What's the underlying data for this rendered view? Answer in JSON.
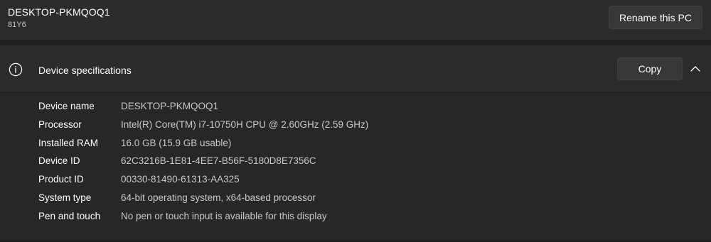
{
  "pc": {
    "name": "DESKTOP-PKMQOQ1",
    "model": "81Y6",
    "rename_label": "Rename this PC"
  },
  "specs": {
    "title": "Device specifications",
    "copy_label": "Copy",
    "icons": {
      "info": "info-icon",
      "collapse": "chevron-up-icon"
    },
    "rows": [
      {
        "label": "Device name",
        "value": "DESKTOP-PKMQOQ1"
      },
      {
        "label": "Processor",
        "value": "Intel(R) Core(TM) i7-10750H CPU @ 2.60GHz (2.59 GHz)"
      },
      {
        "label": "Installed RAM",
        "value": "16.0 GB (15.9 GB usable)"
      },
      {
        "label": "Device ID",
        "value": "62C3216B-1E81-4EE7-B56F-5180D8E7356C"
      },
      {
        "label": "Product ID",
        "value": "00330-81490-61313-AA325"
      },
      {
        "label": "System type",
        "value": "64-bit operating system, x64-based processor"
      },
      {
        "label": "Pen and touch",
        "value": "No pen or touch input is available for this display"
      }
    ]
  },
  "colors": {
    "background": "#202020",
    "card": "#2b2b2b",
    "button": "#373737",
    "text": "#ffffff",
    "secondary_text": "#c9c9c9"
  }
}
